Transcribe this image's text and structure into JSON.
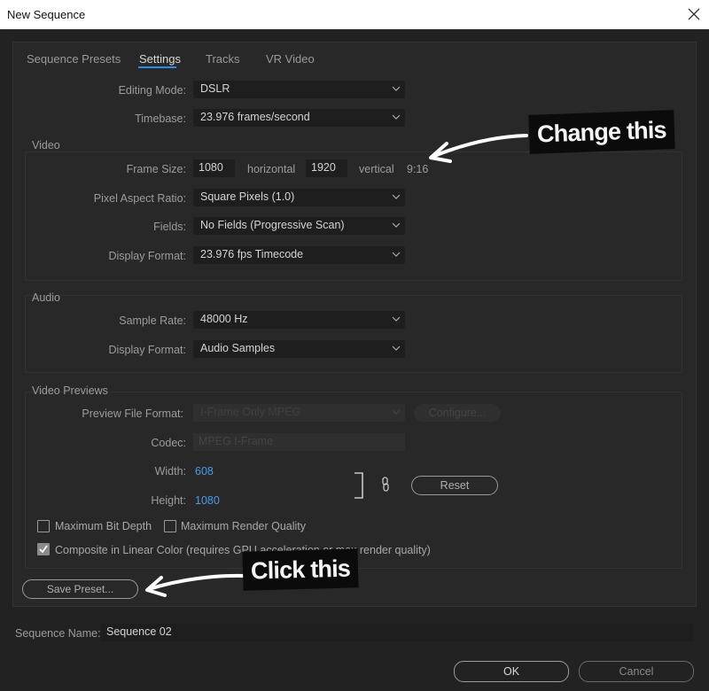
{
  "window": {
    "title": "New Sequence"
  },
  "tabs": [
    {
      "label": "Sequence Presets"
    },
    {
      "label": "Settings"
    },
    {
      "label": "Tracks"
    },
    {
      "label": "VR Video"
    }
  ],
  "settings": {
    "editing_mode": {
      "label": "Editing Mode:",
      "value": "DSLR"
    },
    "timebase": {
      "label": "Timebase:",
      "value": "23.976  frames/second"
    }
  },
  "video": {
    "section_title": "Video",
    "frame_size": {
      "label": "Frame Size:",
      "width": "1080",
      "horizontal_label": "horizontal",
      "height": "1920",
      "vertical_label": "vertical",
      "aspect": "9:16"
    },
    "pixel_aspect_ratio": {
      "label": "Pixel Aspect Ratio:",
      "value": "Square Pixels (1.0)"
    },
    "fields": {
      "label": "Fields:",
      "value": "No Fields (Progressive Scan)"
    },
    "display_format": {
      "label": "Display Format:",
      "value": "23.976 fps Timecode"
    }
  },
  "audio": {
    "section_title": "Audio",
    "sample_rate": {
      "label": "Sample Rate:",
      "value": "48000 Hz"
    },
    "display_format": {
      "label": "Display Format:",
      "value": "Audio Samples"
    }
  },
  "video_previews": {
    "section_title": "Video Previews",
    "preview_file_format": {
      "label": "Preview File Format:",
      "value": "I-Frame Only MPEG"
    },
    "configure_label": "Configure...",
    "codec": {
      "label": "Codec:",
      "value": "MPEG I-Frame"
    },
    "width": {
      "label": "Width:",
      "value": "608"
    },
    "height": {
      "label": "Height:",
      "value": "1080"
    },
    "reset_label": "Reset"
  },
  "options": {
    "max_bit_depth": {
      "label": "Maximum Bit Depth",
      "checked": false
    },
    "max_render_quality": {
      "label": "Maximum Render Quality",
      "checked": false
    },
    "composite_linear": {
      "label": "Composite in Linear Color (requires GPU acceleration or max render quality)",
      "checked": true
    }
  },
  "save_preset_label": "Save Preset...",
  "sequence_name": {
    "label": "Sequence Name:",
    "value": "Sequence 02"
  },
  "buttons": {
    "ok": "OK",
    "cancel": "Cancel"
  },
  "annotations": {
    "change_this": "Change this",
    "click_this": "Click this"
  },
  "colors": {
    "accent": "#2d8ceb",
    "link_value": "#4a9ae8",
    "background": "#222222",
    "panel": "#282828"
  }
}
